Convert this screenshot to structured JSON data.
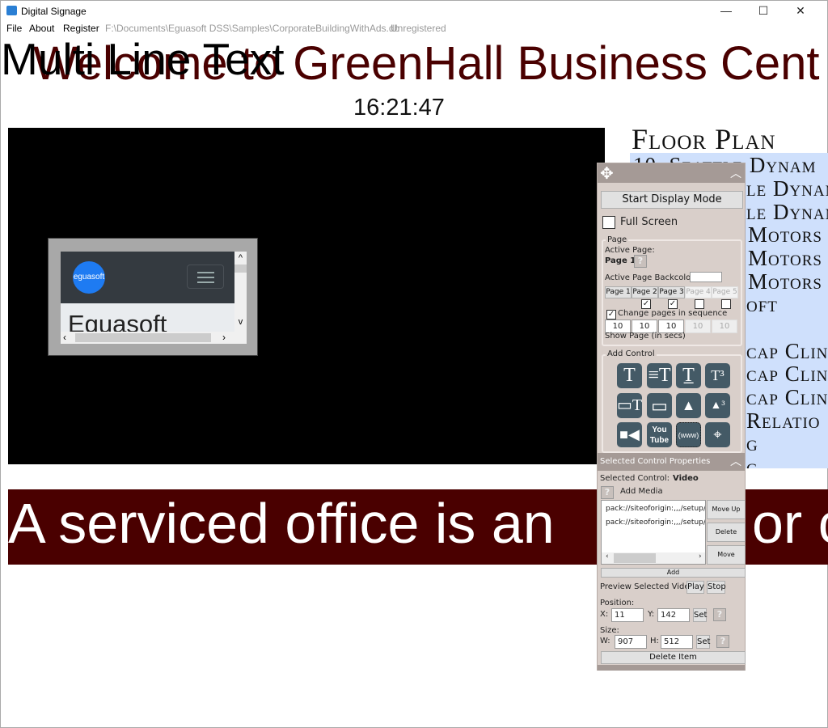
{
  "window": {
    "title": "Digital Signage",
    "minimize": "—",
    "maximize": "☐",
    "close": "✕"
  },
  "menu": {
    "items": [
      "File",
      "About",
      "Register"
    ],
    "path": "F:\\Documents\\Eguasoft DSS\\Samples\\CorporateBuildingWithAds.db",
    "status": "Unregistered"
  },
  "sign": {
    "welcome": "Welcome to GreenHall Business Cent",
    "multi_line": "Multi Line Text",
    "clock": "16:21:47"
  },
  "browser": {
    "logo": "eguasoft",
    "heading": "Eguasoft",
    "logo_color": "#1e7bf2"
  },
  "floor": {
    "title": "Floor Plan",
    "first_item": "10. Seattle Dynam",
    "fragments": [
      "le Dynam",
      "le Dynam",
      "Motors",
      "Motors",
      "Motors",
      "oft",
      "cap Clin",
      "cap Clin",
      "cap Clin",
      "Relatio",
      "g",
      "g"
    ]
  },
  "ticker": {
    "part1": "A serviced office is an",
    "part2": "or c",
    "bg": "#4a0000"
  },
  "panel": {
    "start_display": "Start Display Mode",
    "full_screen": "Full Screen",
    "full_screen_checked": false,
    "page_group": "Page",
    "active_page_label": "Active Page:",
    "active_page": "Page 1",
    "backcolor_label": "Active Page Backcolor:",
    "pages": [
      {
        "label": "Page 1",
        "enabled": true,
        "checked": null,
        "secs": "10"
      },
      {
        "label": "Page 2",
        "enabled": true,
        "checked": true,
        "secs": "10"
      },
      {
        "label": "Page 3",
        "enabled": true,
        "checked": true,
        "secs": "10"
      },
      {
        "label": "Page 4",
        "enabled": false,
        "checked": false,
        "secs": "10"
      },
      {
        "label": "Page 5",
        "enabled": false,
        "checked": false,
        "secs": "10"
      }
    ],
    "sequence_label": "Change pages in sequence",
    "sequence_checked": true,
    "show_page_label": "Show Page (in secs)",
    "add_control": "Add Control",
    "controls": [
      "text-icon",
      "scrolling-text-icon",
      "stretched-text-icon",
      "text-sequence-icon",
      "input-text-icon",
      "rectangle-icon",
      "image-icon",
      "image-sequence-icon",
      "video-icon",
      "youtube-icon",
      "www-icon",
      "map-icon"
    ],
    "props_header": "Selected Control Properties",
    "selected_label": "Selected Control:",
    "selected_value": "Video",
    "add_media": "Add Media",
    "media": [
      "pack://siteoforigin:,,,/setup/in",
      "pack://siteoforigin:,,,/setup/in"
    ],
    "move_up": "Move Up",
    "delete": "Delete",
    "move_down": "Move Down",
    "add": "Add",
    "preview_label": "Preview Selected Video:",
    "play": "Play",
    "stop": "Stop",
    "position_label": "Position:",
    "x_label": "X:",
    "x": "11",
    "y_label": "Y:",
    "y": "142",
    "set": "Set",
    "size_label": "Size:",
    "w_label": "W:",
    "w": "907",
    "h_label": "H:",
    "h": "512",
    "delete_item": "Delete Item",
    "help": "?"
  }
}
